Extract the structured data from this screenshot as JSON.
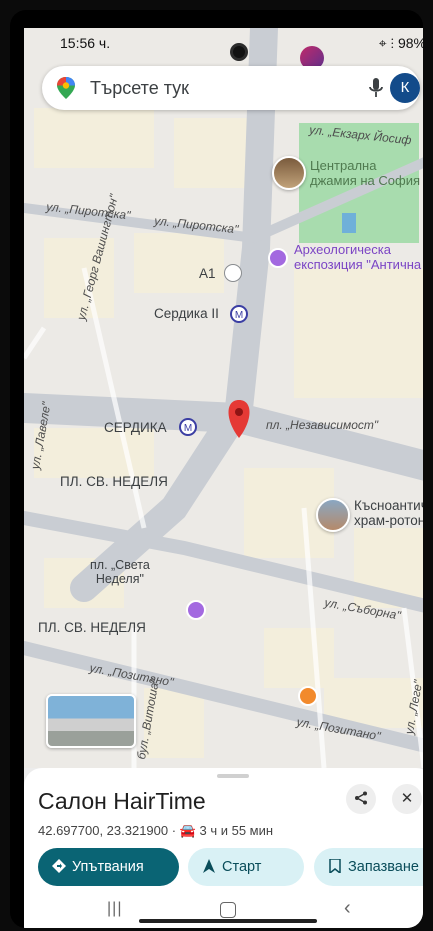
{
  "status_bar": {
    "time": "15:56 ч.",
    "battery": "98%"
  },
  "search": {
    "placeholder": "Търсете тук",
    "account_initial": "К"
  },
  "map": {
    "labels": {
      "st_ekzarh": "ул. „Екзарх Йосиф",
      "mosque": "Централна\nджамия на София",
      "pirotska1": "ул. „Пиротска\"",
      "pirotska2": "ул. „Пиротска\"",
      "archaeo": "Археологическа\nекспозиция \"Антична",
      "a1": "A1",
      "serdika2": "Сердика II",
      "georg": "ул. „Георг Вашингтон\"",
      "serdika": "СЕРДИКА",
      "nezav": "пл. „Независимост\"",
      "lavele": "ул. „Лавеле\"",
      "nedelya1": "ПЛ. СВ. НЕДЕЛЯ",
      "kasnoant": "Късноантич\nхрам-ротон",
      "sveta_nedelya": "пл. „Света\nНеделя\"",
      "sabornа": "ул. „Съборна\"",
      "nedelya2": "ПЛ. СВ. НЕДЕЛЯ",
      "pozitano1": "ул. „Позитано\"",
      "lege": "ул. „Леге\"",
      "vitosha": "бул. „Витоша\"",
      "pozitano2": "ул. „Позитано\""
    },
    "colors": {
      "pin": "#e53935",
      "park": "#a8dcae",
      "road": "#c9cdd3",
      "block": "#f3eedc"
    }
  },
  "sheet": {
    "title": "Салон HairTime",
    "coords": "42.697700, 23.321900 · ",
    "drive_time": "3 ч и 55 мин",
    "share_icon": "share-icon",
    "close_label": "✕",
    "buttons": {
      "directions": "Упътвания",
      "start": "Старт",
      "save": "Запазване"
    }
  }
}
